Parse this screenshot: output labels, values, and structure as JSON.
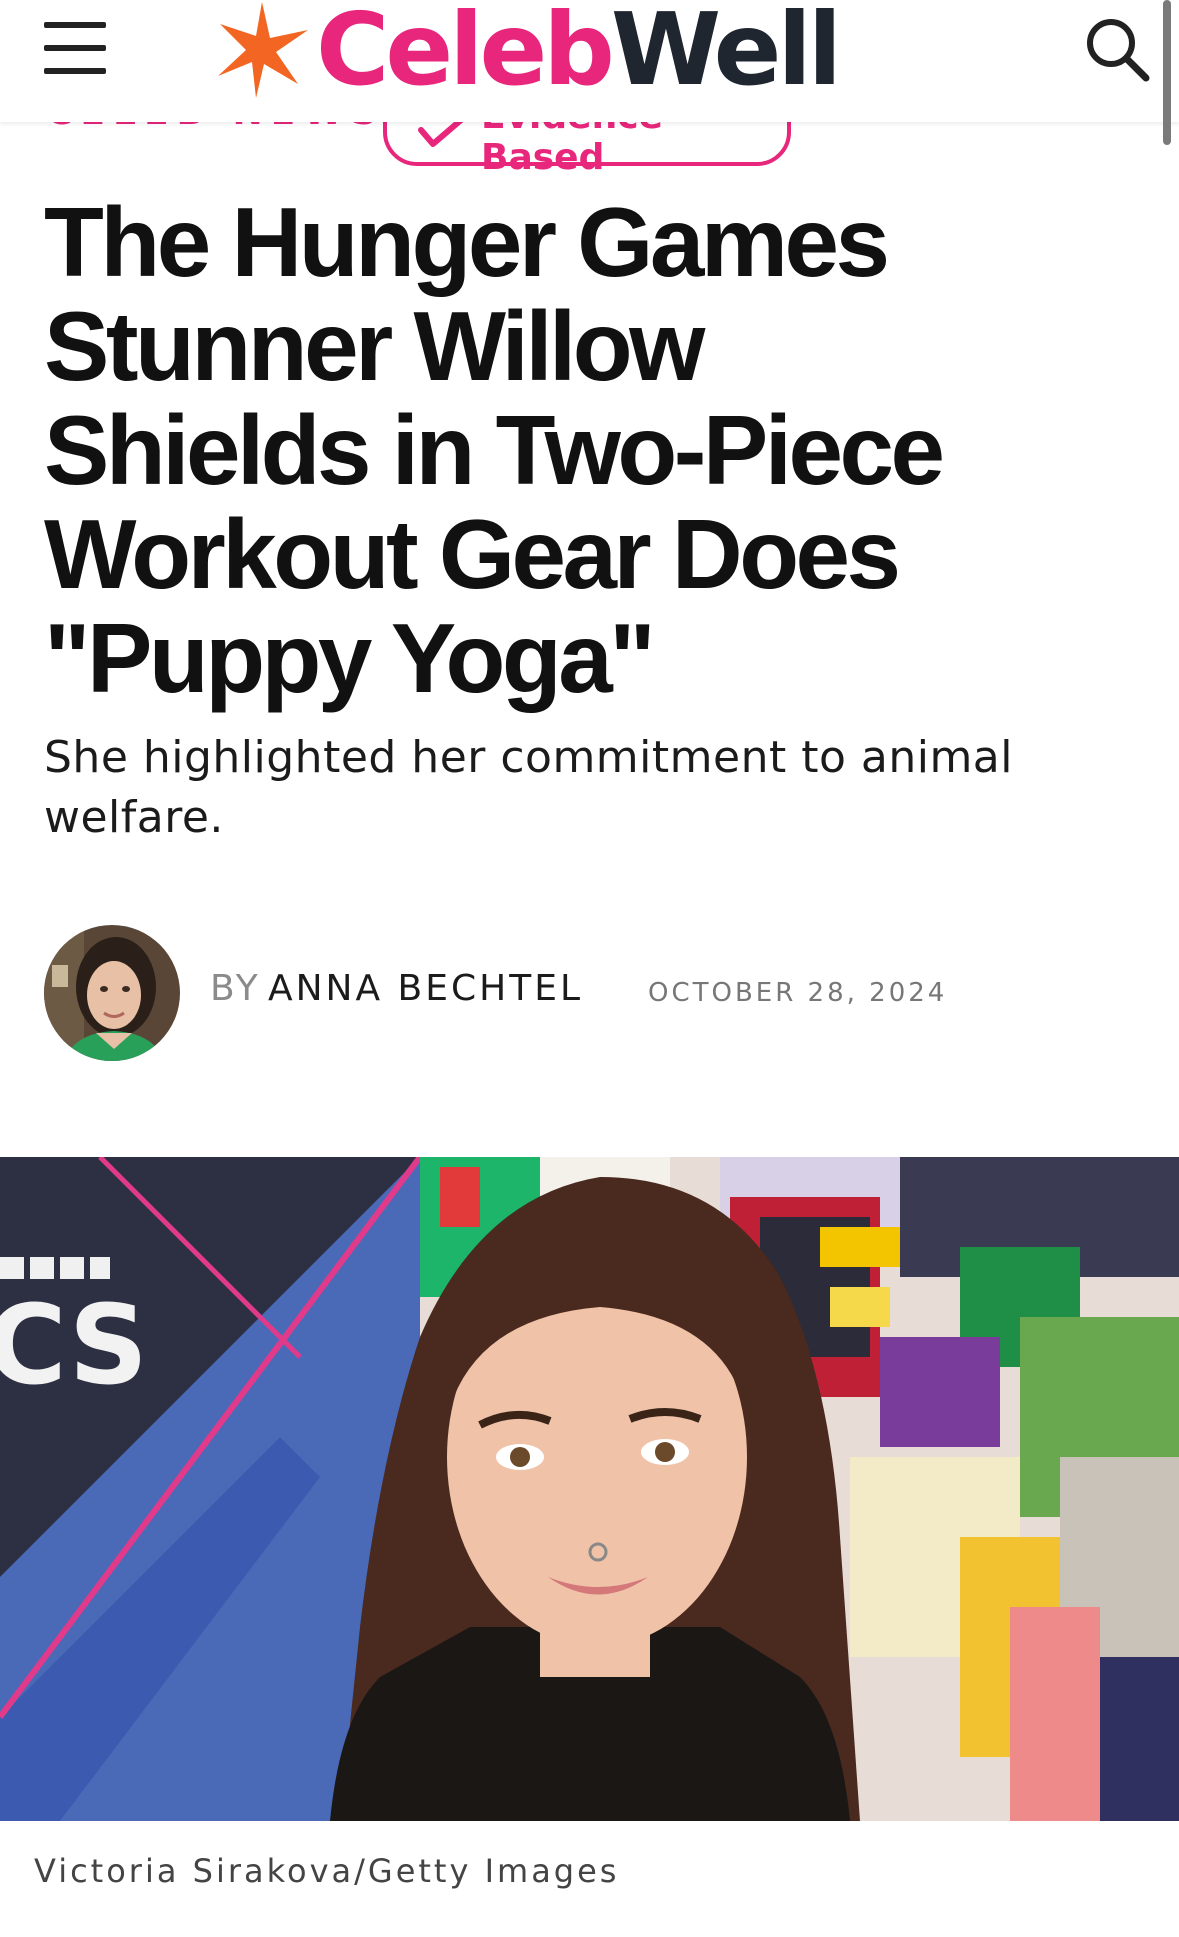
{
  "header": {
    "logo_part1": "Celeb",
    "logo_part2": "Well",
    "menu_icon": "hamburger-menu-icon",
    "search_icon": "search-icon"
  },
  "tags": {
    "category": "CELEB NEWS",
    "evidence_badge": "Evidence-Based"
  },
  "article": {
    "headline": "The Hunger Games Stunner Willow Shields in Two-Piece Workout Gear Does \"Puppy Yoga\"",
    "dek": "She highlighted her commitment to animal welfare.",
    "byline_prefix": "BY",
    "author": "ANNA BECHTEL",
    "date": "OCTOBER 28, 2024",
    "hero_backdrop_text": "CS",
    "image_caption": "Victoria Sirakova/Getty Images"
  },
  "colors": {
    "brand_pink": "#e8267c",
    "brand_orange": "#f26522",
    "brand_dark": "#1f2630"
  }
}
